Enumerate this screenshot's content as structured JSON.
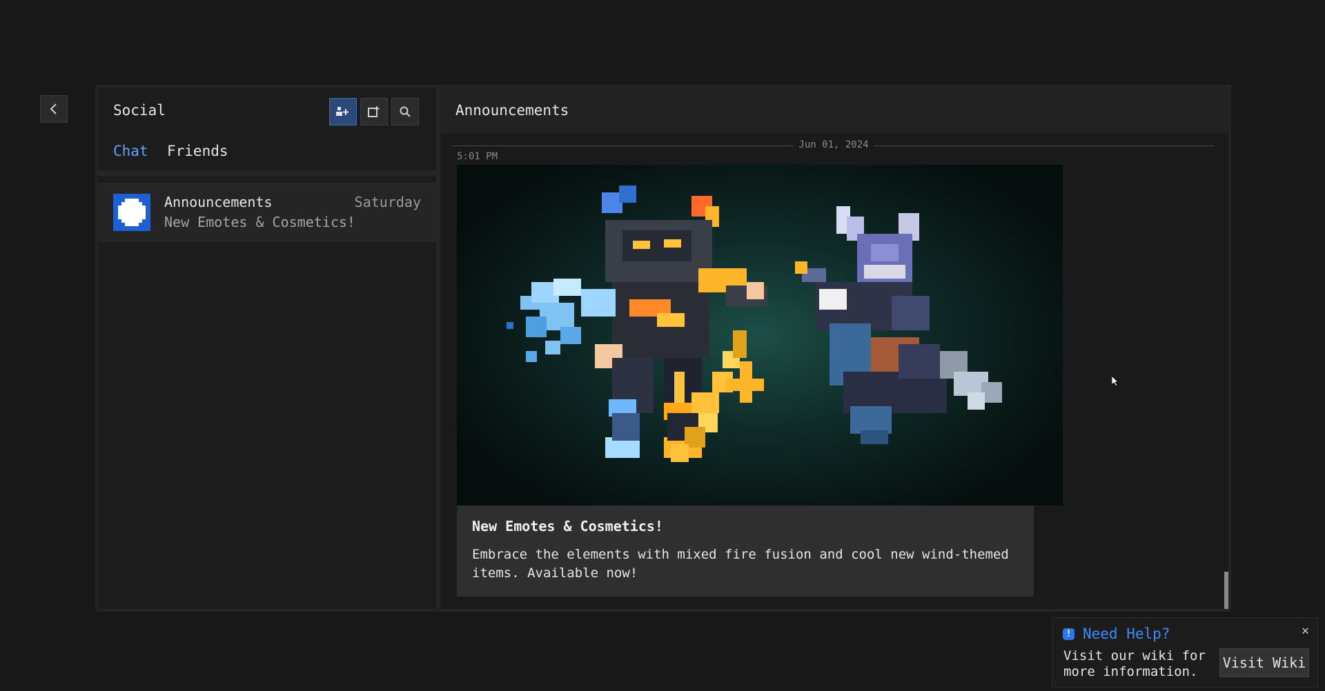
{
  "back_button": {
    "icon": "chevron-left-icon"
  },
  "social": {
    "title": "Social",
    "buttons": [
      {
        "icon": "add-friend-icon",
        "active": true
      },
      {
        "icon": "share-icon",
        "active": false
      },
      {
        "icon": "search-icon",
        "active": false
      }
    ],
    "tabs": [
      {
        "label": "Chat",
        "active": true
      },
      {
        "label": "Friends",
        "active": false
      }
    ],
    "conversations": [
      {
        "name": "Announcements",
        "day": "Saturday",
        "preview": "New Emotes & Cosmetics!",
        "avatar_color": "#1e5fd6"
      }
    ]
  },
  "announcements": {
    "title": "Announcements",
    "date": "Jun 01, 2024",
    "time": "5:01 PM",
    "post": {
      "title": "New Emotes & Cosmetics!",
      "body": "Embrace the elements with mixed fire fusion and cool new wind-themed items. Available now!"
    }
  },
  "help": {
    "title": "Need Help?",
    "body": "Visit our wiki for more information.",
    "button_label": "Visit Wiki"
  },
  "colors": {
    "accent": "#3d8bff",
    "avatar": "#1e5fd6",
    "background": "#181818"
  }
}
